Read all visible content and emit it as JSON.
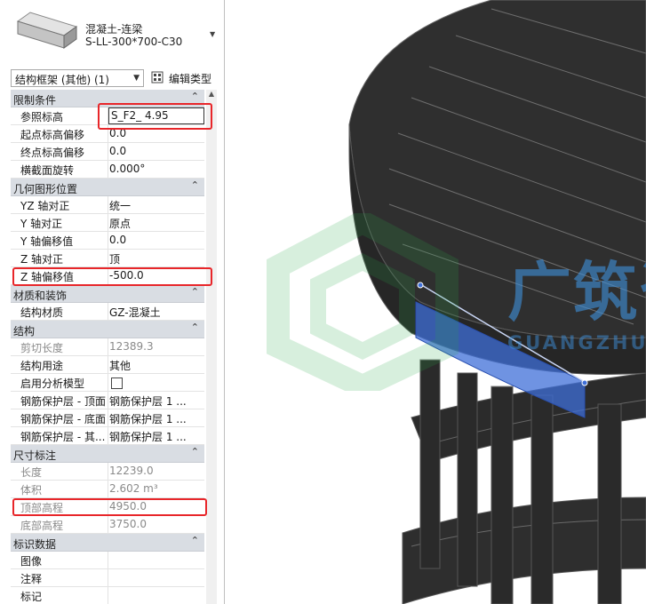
{
  "type_selector": {
    "family": "混凝土-连梁",
    "type": "S-LL-300*700-C30"
  },
  "filter": {
    "selected": "结构框架 (其他) (1)",
    "edit_type_label": "编辑类型"
  },
  "groups": [
    {
      "name": "限制条件",
      "rows": [
        {
          "label": "参照标高",
          "value": "S_F2_ 4.95"
        },
        {
          "label": "起点标高偏移",
          "value": "0.0"
        },
        {
          "label": "终点标高偏移",
          "value": "0.0"
        },
        {
          "label": "横截面旋转",
          "value": "0.000°"
        }
      ]
    },
    {
      "name": "几何图形位置",
      "rows": [
        {
          "label": "YZ 轴对正",
          "value": "统一"
        },
        {
          "label": "Y 轴对正",
          "value": "原点"
        },
        {
          "label": "Y 轴偏移值",
          "value": "0.0"
        },
        {
          "label": "Z 轴对正",
          "value": "顶"
        },
        {
          "label": "Z 轴偏移值",
          "value": "-500.0"
        }
      ]
    },
    {
      "name": "材质和装饰",
      "rows": [
        {
          "label": "结构材质",
          "value": "GZ-混凝土"
        }
      ]
    },
    {
      "name": "结构",
      "rows": [
        {
          "label": "剪切长度",
          "value": "12389.3"
        },
        {
          "label": "结构用途",
          "value": "其他"
        },
        {
          "label": "启用分析模型",
          "value": ""
        },
        {
          "label": "钢筋保护层 - 顶面",
          "value": "钢筋保护层 1 ..."
        },
        {
          "label": "钢筋保护层 - 底面",
          "value": "钢筋保护层 1 ..."
        },
        {
          "label": "钢筋保护层 - 其...",
          "value": "钢筋保护层 1 ..."
        }
      ]
    },
    {
      "name": "尺寸标注",
      "rows": [
        {
          "label": "长度",
          "value": "12239.0"
        },
        {
          "label": "体积",
          "value": "2.602 m³"
        },
        {
          "label": "顶部高程",
          "value": "4950.0"
        },
        {
          "label": "底部高程",
          "value": "3750.0"
        }
      ]
    },
    {
      "name": "标识数据",
      "rows": [
        {
          "label": "图像",
          "value": ""
        },
        {
          "label": "注释",
          "value": ""
        },
        {
          "label": "标记",
          "value": ""
        }
      ]
    }
  ],
  "watermark": {
    "cn": "广筑咨询",
    "en": "GUANGZHU CONSULTATION"
  },
  "colors": {
    "highlight": "#e8262a",
    "selection_blue": "#3f6fd8",
    "model_dark": "#2b2b2b",
    "watermark_blue": "#3f8fd8"
  },
  "icons": {
    "collapse": "chevron-up-icon",
    "dropdown": "chevron-down-icon",
    "edit_type": "edit-type-icon",
    "beam_thumbnail": "beam-thumbnail-icon"
  }
}
